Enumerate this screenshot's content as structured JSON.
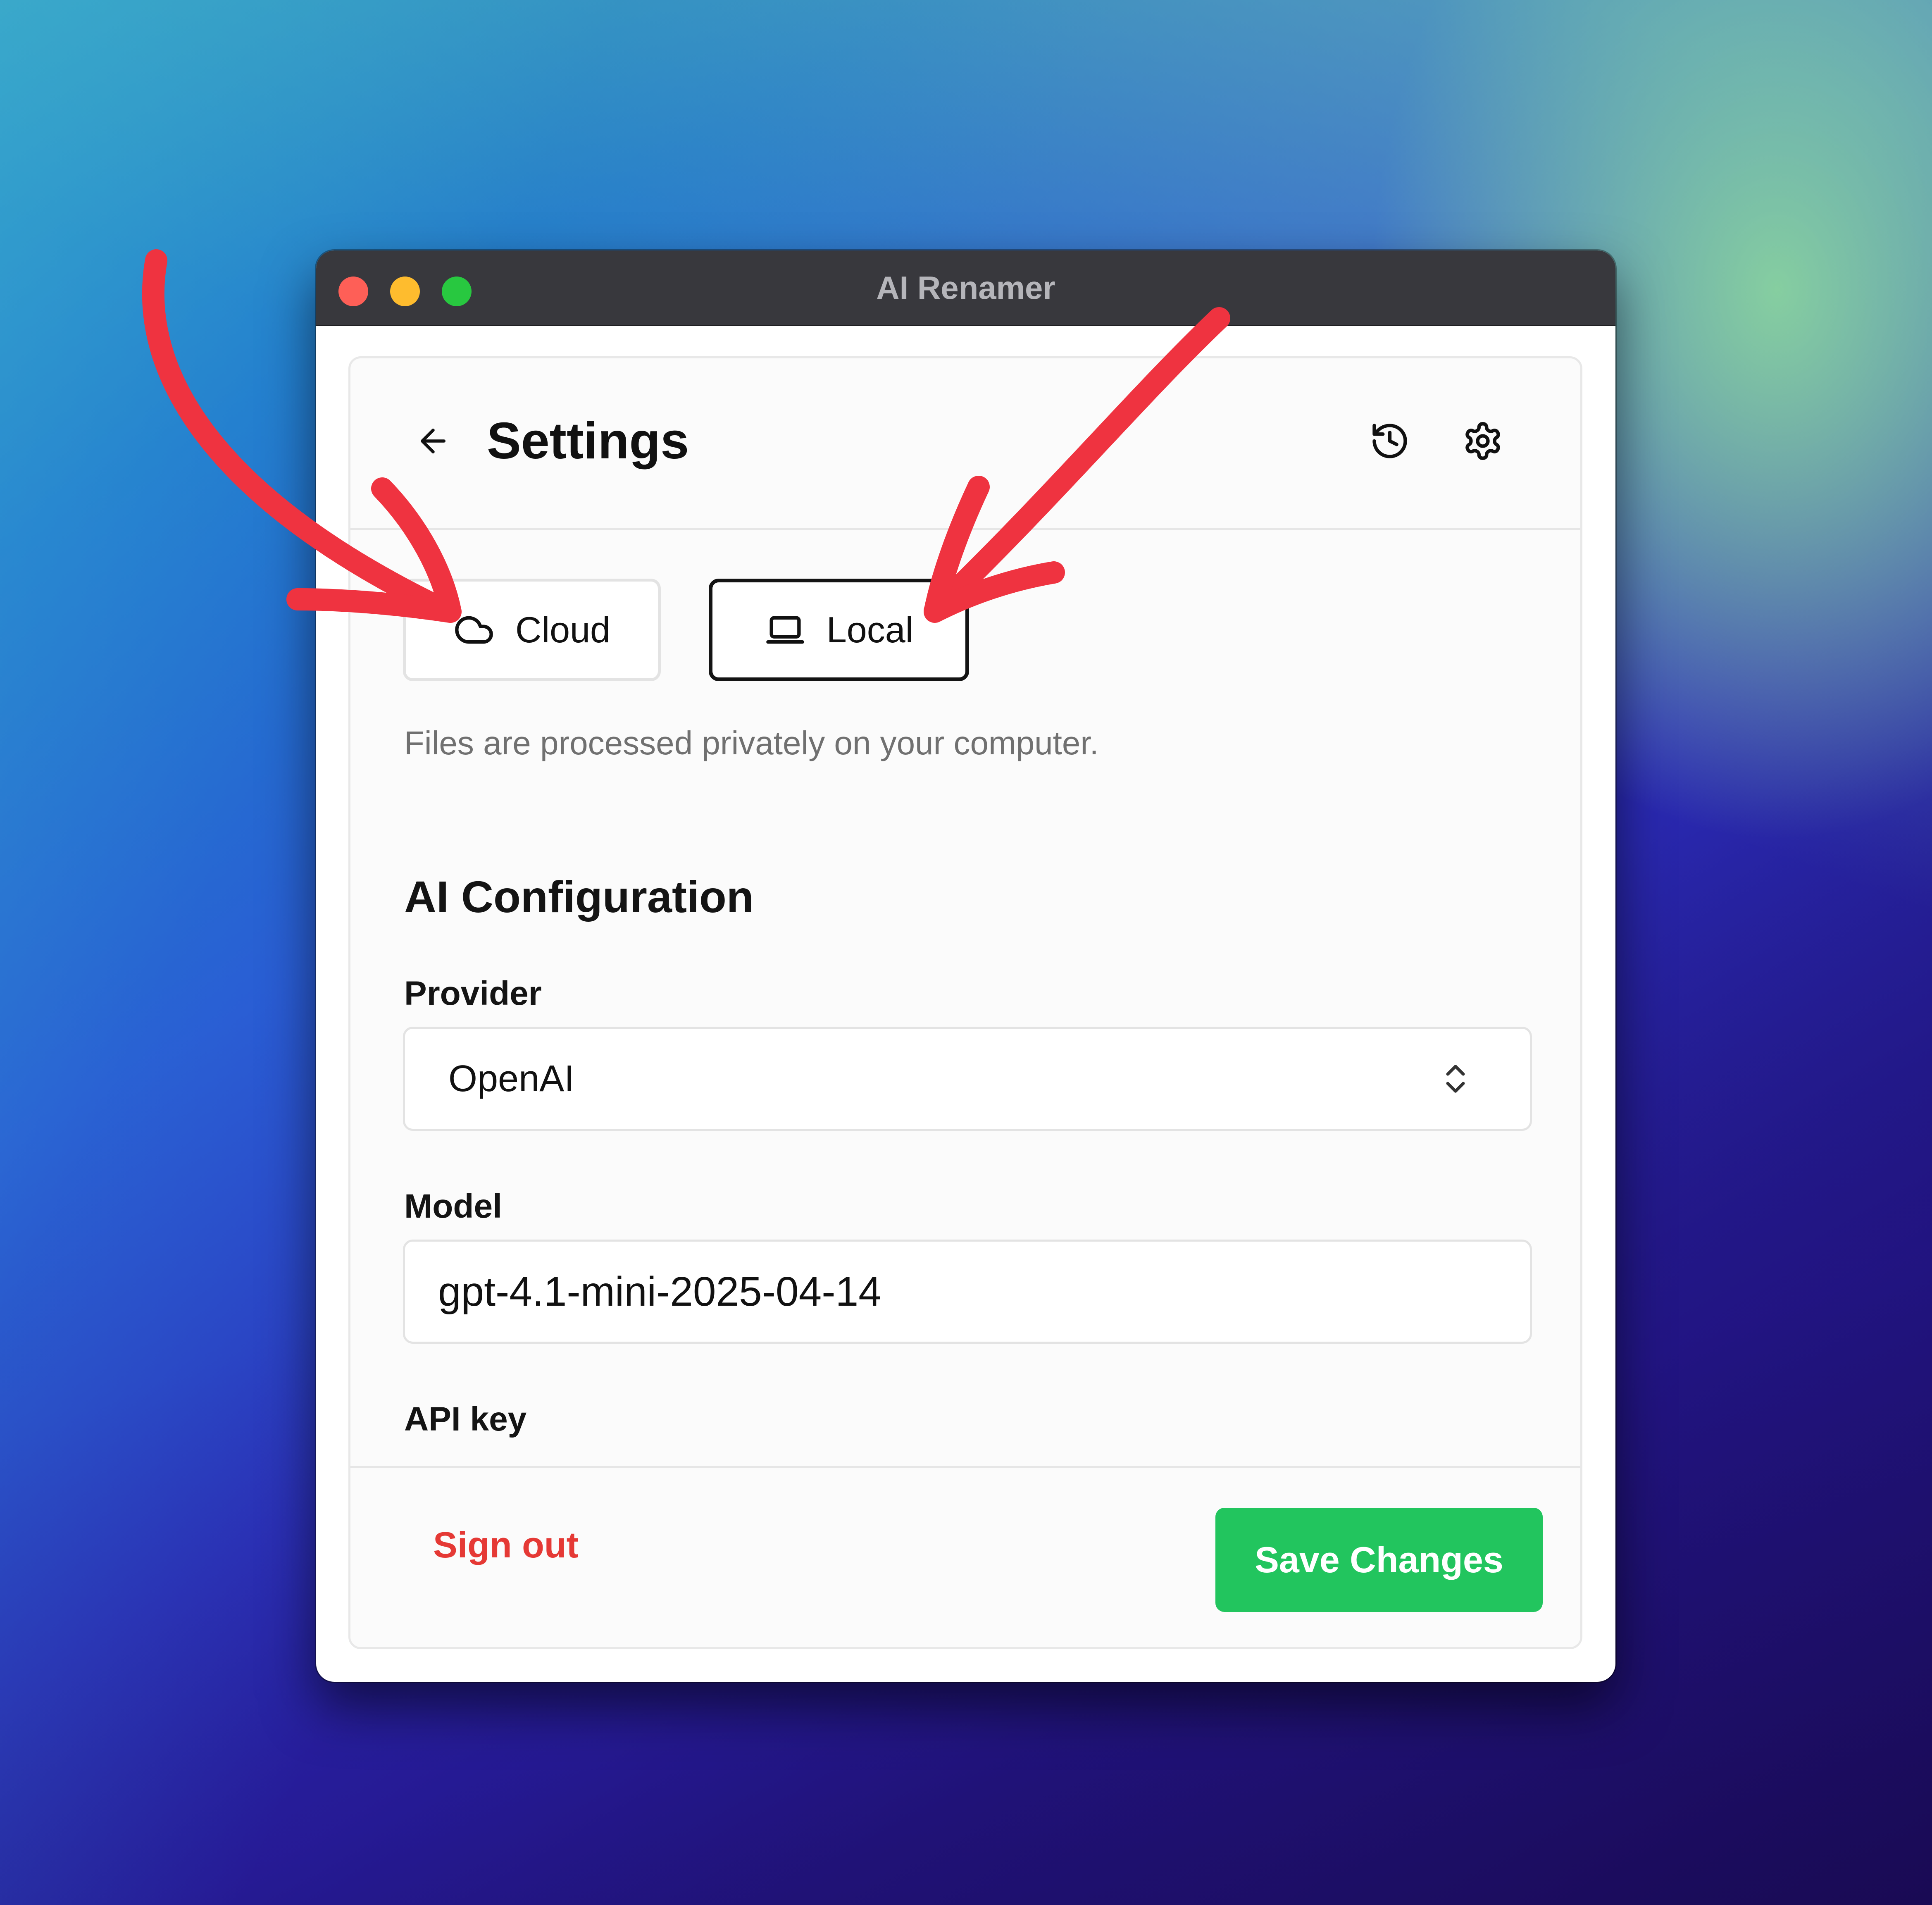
{
  "window": {
    "title": "AI Renamer"
  },
  "header": {
    "title": "Settings",
    "icons": [
      "back-arrow-icon",
      "history-icon",
      "gear-icon"
    ]
  },
  "mode": {
    "options": [
      {
        "label": "Cloud",
        "icon": "cloud-icon",
        "selected": false
      },
      {
        "label": "Local",
        "icon": "laptop-icon",
        "selected": true
      }
    ],
    "hint": "Files are processed privately on your computer."
  },
  "ai_config": {
    "title": "AI Configuration",
    "provider_label": "Provider",
    "provider_value": "OpenAI",
    "model_label": "Model",
    "model_value": "gpt-4.1-mini-2025-04-14",
    "api_key_label": "API key"
  },
  "footer": {
    "signout_label": "Sign out",
    "save_label": "Save Changes"
  },
  "colors": {
    "accent_green": "#22c55e",
    "danger_red": "#e53935",
    "annotation_red": "#ef3340",
    "titlebar": "#38383d"
  }
}
